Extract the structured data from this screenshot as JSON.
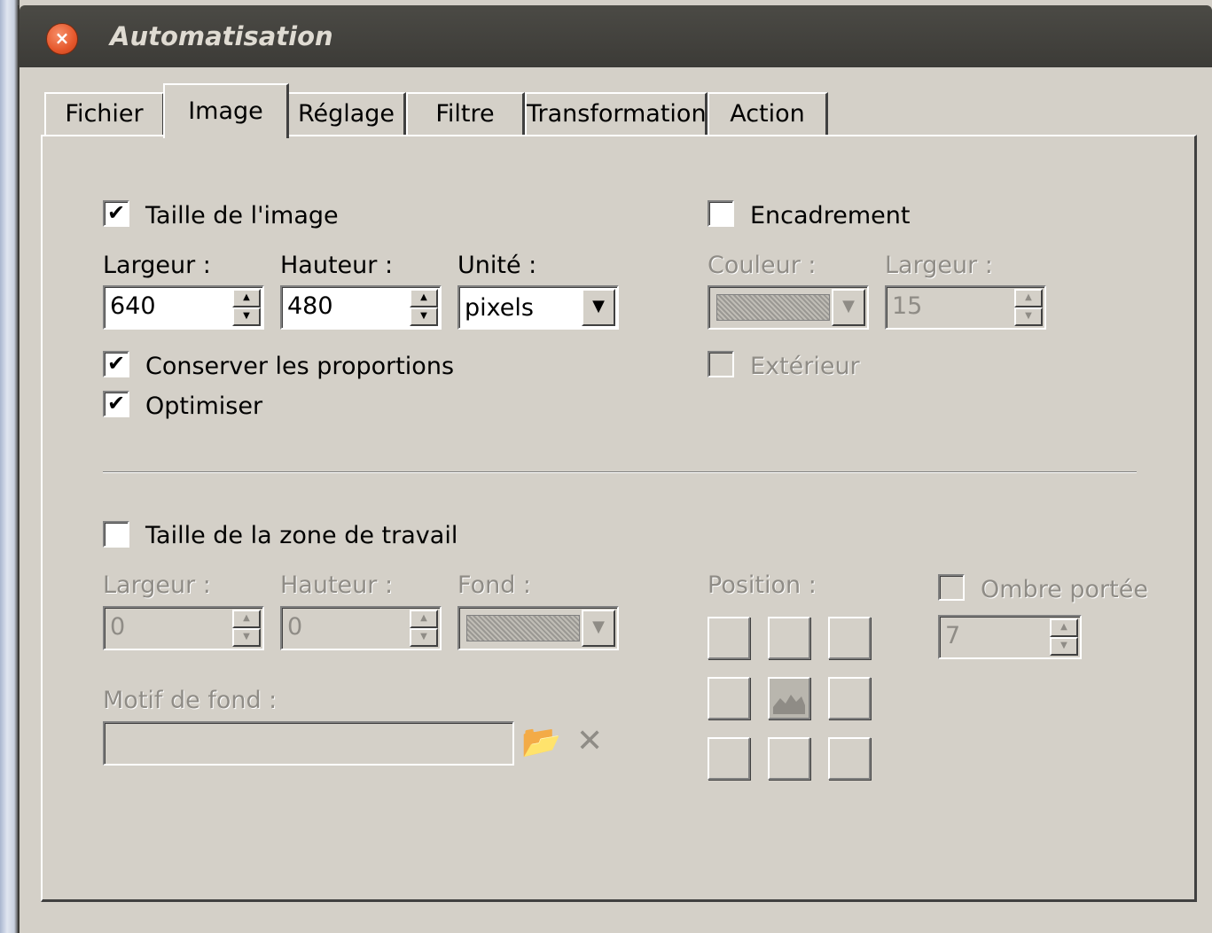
{
  "window": {
    "title": "Automatisation",
    "close_glyph": "×"
  },
  "tabs": [
    {
      "label": "Fichier",
      "active": false
    },
    {
      "label": "Image",
      "active": true
    },
    {
      "label": "Réglage",
      "active": false
    },
    {
      "label": "Filtre",
      "active": false
    },
    {
      "label": "Transformation",
      "active": false
    },
    {
      "label": "Action",
      "active": false
    }
  ],
  "image_size": {
    "checkbox_label": "Taille de l'image",
    "checked": true,
    "width_label": "Largeur :",
    "width_value": "640",
    "height_label": "Hauteur :",
    "height_value": "480",
    "unit_label": "Unité :",
    "unit_value": "pixels",
    "keep_ratio_label": "Conserver les proportions",
    "keep_ratio_checked": true,
    "optimize_label": "Optimiser",
    "optimize_checked": true
  },
  "frame": {
    "checkbox_label": "Encadrement",
    "checked": false,
    "color_label": "Couleur :",
    "width_label": "Largeur :",
    "width_value": "15",
    "outside_label": "Extérieur",
    "outside_checked": false
  },
  "canvas_size": {
    "checkbox_label": "Taille de la zone de travail",
    "checked": false,
    "width_label": "Largeur :",
    "width_value": "0",
    "height_label": "Hauteur :",
    "height_value": "0",
    "background_label": "Fond :",
    "pattern_label": "Motif de fond :",
    "pattern_value": "",
    "position_label": "Position :",
    "shadow_label": "Ombre portée",
    "shadow_checked": false,
    "shadow_value": "7"
  },
  "icons": {
    "check": "✔",
    "spin_up": "▲",
    "spin_down": "▼",
    "dropdown": "▼",
    "open_folder": "📂",
    "clear": "✕"
  },
  "colors": {
    "dialog_bg": "#d4d0c8",
    "titlebar": "#3c3b37",
    "close_button": "#e5572b",
    "disabled_text": "#8f8c86"
  }
}
